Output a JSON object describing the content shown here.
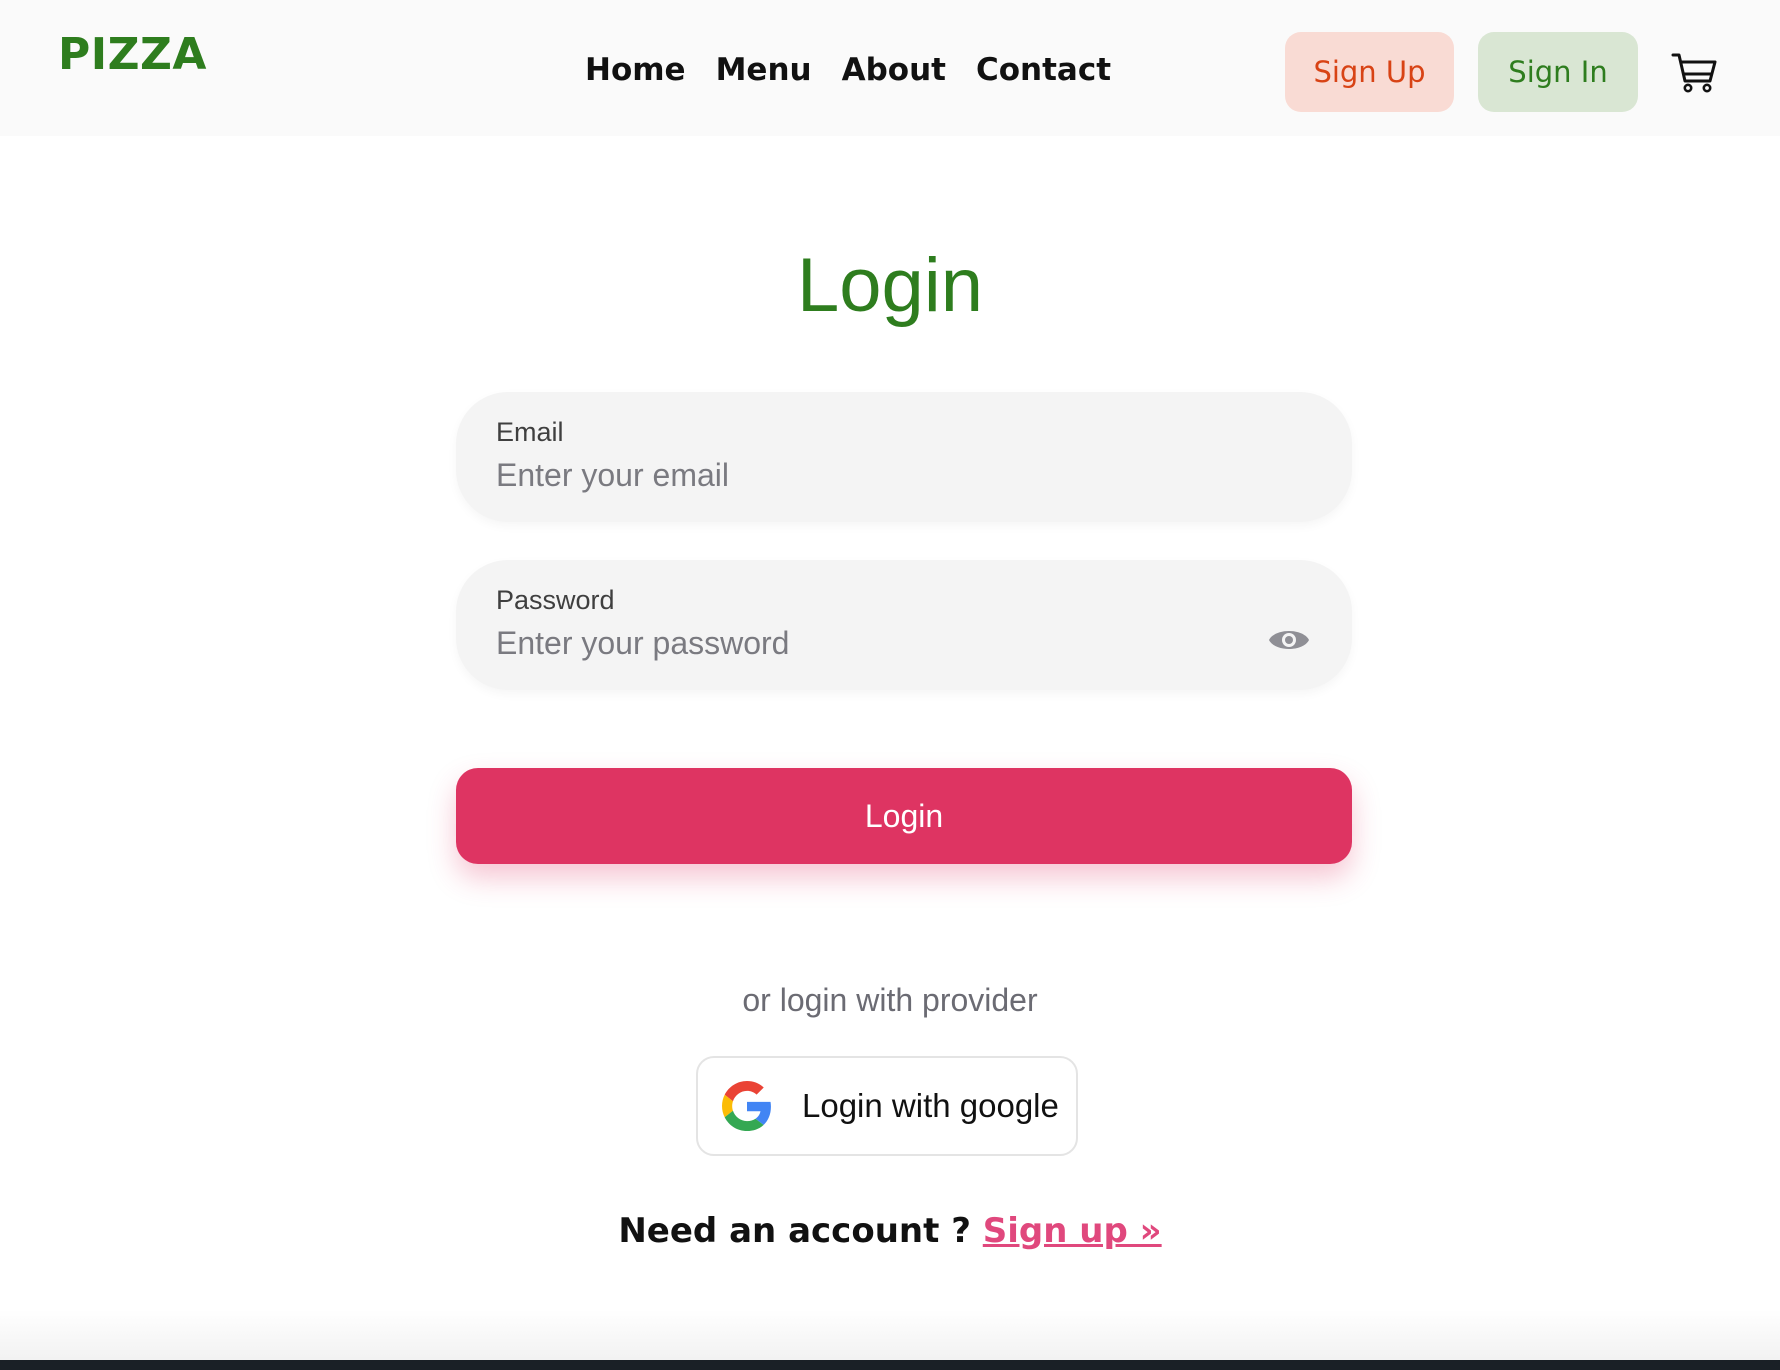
{
  "header": {
    "logo": "PIZZA",
    "nav": [
      "Home",
      "Menu",
      "About",
      "Contact"
    ],
    "signup_label": "Sign Up",
    "signin_label": "Sign In",
    "cart_icon": "cart-icon"
  },
  "login": {
    "title": "Login",
    "email": {
      "label": "Email",
      "placeholder": "Enter your email",
      "value": ""
    },
    "password": {
      "label": "Password",
      "placeholder": "Enter your password",
      "value": ""
    },
    "submit_label": "Login",
    "provider_text": "or login with provider",
    "google_label": "Login with google",
    "need_account_text": "Need an account ?",
    "signup_link": "Sign up »"
  },
  "colors": {
    "brand_green": "#2e7d1e",
    "accent_pink": "#de3462",
    "signup_bg": "#f9dbd4",
    "signup_text": "#d84315",
    "signin_bg": "#d9e6d3",
    "link_pink": "#e0487d"
  }
}
